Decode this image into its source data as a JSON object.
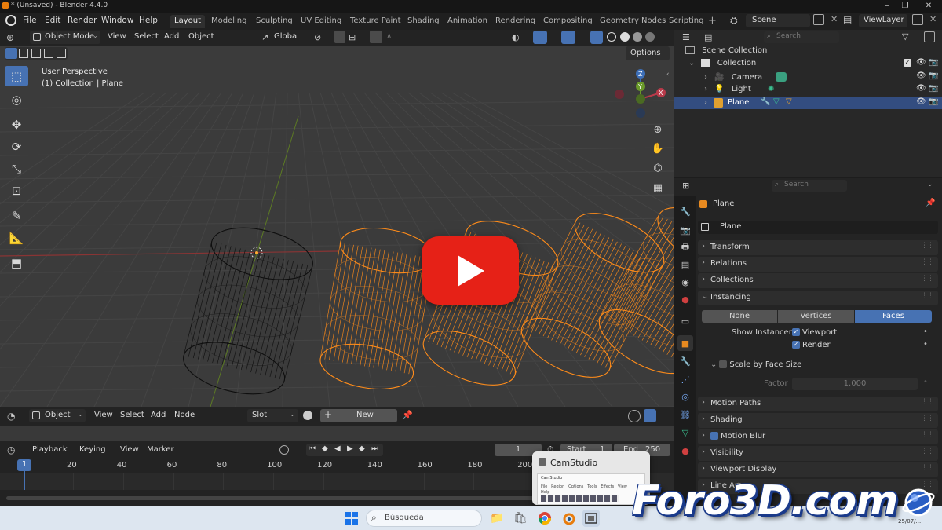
{
  "window": {
    "title": "* (Unsaved) - Blender 4.4.0",
    "min": "–",
    "max": "❐",
    "close": "✕"
  },
  "menu": [
    "File",
    "Edit",
    "Render",
    "Window",
    "Help"
  ],
  "workspaces": [
    {
      "label": "Layout",
      "active": true
    },
    {
      "label": "Modeling"
    },
    {
      "label": "Sculpting"
    },
    {
      "label": "UV Editing"
    },
    {
      "label": "Texture Paint"
    },
    {
      "label": "Shading"
    },
    {
      "label": "Animation"
    },
    {
      "label": "Rendering"
    },
    {
      "label": "Compositing"
    },
    {
      "label": "Geometry Nodes"
    },
    {
      "label": "Scripting"
    }
  ],
  "scene": {
    "name": "Scene",
    "view_layer": "ViewLayer"
  },
  "viewport": {
    "mode": "Object Mode",
    "menus": [
      "View",
      "Select",
      "Add",
      "Object"
    ],
    "orientation": "Global",
    "options": "Options",
    "overlay_title": "User Perspective",
    "overlay_sub": "(1) Collection | Plane",
    "gizmo": {
      "z": "Z",
      "y": "Y",
      "x": "X"
    }
  },
  "outliner": {
    "search_placeholder": "Search",
    "root": "Scene Collection",
    "collection": "Collection",
    "items": [
      "Camera",
      "Light",
      "Plane"
    ]
  },
  "properties": {
    "search_placeholder": "Search",
    "object_name": "Plane",
    "object_field": "Plane",
    "panels_top": [
      "Transform",
      "Relations",
      "Collections"
    ],
    "instancing": {
      "label": "Instancing",
      "options": [
        "None",
        "Vertices",
        "Faces"
      ],
      "active": "Faces",
      "show_instancer": "Show Instancer",
      "viewport": "Viewport",
      "render": "Render",
      "scale_by_face_size": "Scale by Face Size",
      "factor_label": "Factor",
      "factor_value": "1.000"
    },
    "panels_bottom": [
      "Motion Paths",
      "Shading",
      "Motion Blur",
      "Visibility",
      "Viewport Display",
      "Line Art"
    ]
  },
  "shader_editor": {
    "mode": "Object",
    "menus": [
      "View",
      "Select",
      "Add",
      "Node"
    ],
    "slot": "Slot",
    "new_button": "New",
    "plus": "+"
  },
  "timeline": {
    "menus": [
      "Playback",
      "Keying",
      "View",
      "Marker"
    ],
    "current_frame": "1",
    "start_label": "Start",
    "start_value": "1",
    "end_label": "End",
    "end_value": "250",
    "ticks": [
      "1",
      "20",
      "40",
      "60",
      "80",
      "100",
      "120",
      "140",
      "160",
      "180",
      "200"
    ]
  },
  "taskbar": {
    "search_placeholder": "Búsqueda",
    "preview_title": "CamStudio",
    "preview_app": "CamStudio",
    "preview_menu": [
      "File",
      "Region",
      "Options",
      "Tools",
      "Effects",
      "View",
      "Help"
    ],
    "clock": "25/07/..."
  },
  "watermark": "Foro3D.com",
  "colors": {
    "accent": "#4772b3",
    "selection": "#ff8c1a",
    "wire": "#0a0a0a",
    "youtube": "#e62117",
    "watermark_outline": "#1a3a8a"
  }
}
